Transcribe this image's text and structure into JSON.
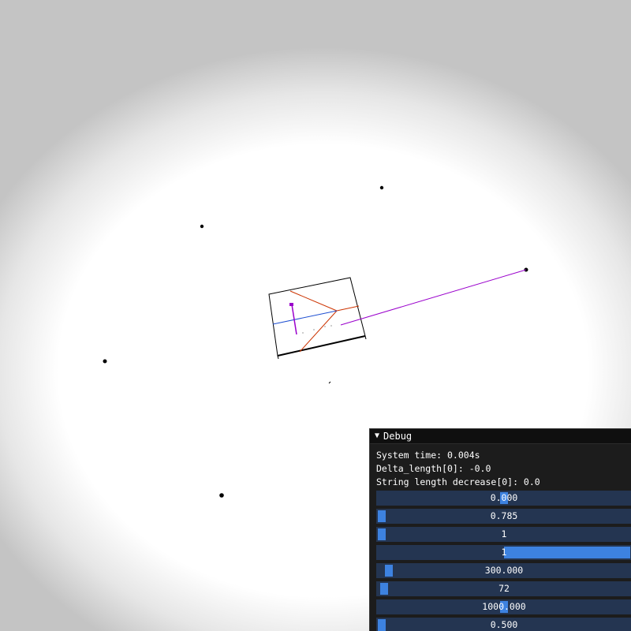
{
  "debug": {
    "title": "Debug",
    "system_time": "System time: 0.004s",
    "delta_length": "Delta_length[0]: -0.0",
    "string_length_decrease": "String length decrease[0]: 0.0",
    "sliders": [
      {
        "value": "0.000",
        "fill_fraction": 0.5
      },
      {
        "value": "0.785",
        "fill_fraction": 0.0
      },
      {
        "value": "1",
        "fill_fraction": 0.0
      },
      {
        "value": "1",
        "fill_fraction": 1.0
      },
      {
        "value": "300.000",
        "fill_fraction": 0.03
      },
      {
        "value": "72",
        "fill_fraction": 0.01
      },
      {
        "value": "1000.000",
        "fill_fraction": 0.5
      },
      {
        "value": "0.500",
        "fill_fraction": 0.0
      }
    ]
  },
  "colors": {
    "panel_bg": "#1c1c1c",
    "title_bg": "#0f0f0f",
    "slider_bg": "#243551",
    "slider_grab": "#3d82e0",
    "string_line": "#9a00cc",
    "frame_red": "#cc3300",
    "axis_blue": "#1e4fd1"
  },
  "icons": {
    "collapse": "triangle-down-icon"
  }
}
